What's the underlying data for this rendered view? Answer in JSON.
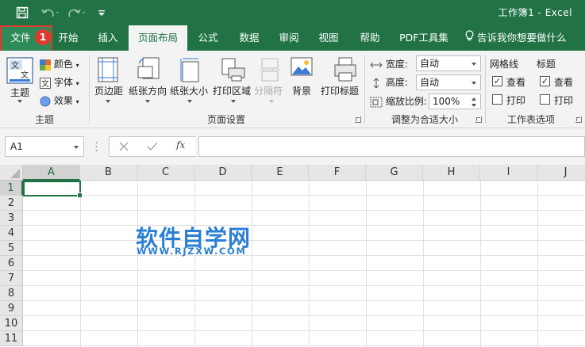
{
  "window": {
    "title": "工作簿1  -  Excel"
  },
  "tabs": [
    {
      "label": "文件"
    },
    {
      "label": "开始"
    },
    {
      "label": "插入"
    },
    {
      "label": "页面布局"
    },
    {
      "label": "公式"
    },
    {
      "label": "数据"
    },
    {
      "label": "审阅"
    },
    {
      "label": "视图"
    },
    {
      "label": "帮助"
    },
    {
      "label": "PDF工具集"
    }
  ],
  "tell_me": "告诉我你想要做什么",
  "badge": "1",
  "ribbon": {
    "themes": {
      "theme_label": "主题",
      "colors_label": "颜色",
      "fonts_label": "字体",
      "effects_label": "效果",
      "group_label": "主题"
    },
    "page_setup": {
      "margins": "页边距",
      "orientation": "纸张方向",
      "size": "纸张大小",
      "print_area": "打印区域",
      "breaks": "分隔符",
      "background": "背景",
      "print_titles": "打印标题",
      "group_label": "页面设置"
    },
    "scale_to_fit": {
      "width_label": "宽度:",
      "width_value": "自动",
      "height_label": "高度:",
      "height_value": "自动",
      "scale_label": "缩放比例:",
      "scale_value": "100%",
      "group_label": "调整为合适大小"
    },
    "sheet_options": {
      "gridlines_label": "网格线",
      "gridlines_view": "查看",
      "gridlines_print": "打印",
      "headings_label": "标题",
      "headings_view": "查看",
      "headings_print": "打印",
      "group_label": "工作表选项"
    }
  },
  "formula_bar": {
    "name_box": "A1",
    "fx": "fx",
    "value": ""
  },
  "columns": [
    "A",
    "B",
    "C",
    "D",
    "E",
    "F",
    "G",
    "H",
    "I",
    "J"
  ],
  "rows": [
    "1",
    "2",
    "3",
    "4",
    "5",
    "6",
    "7",
    "8",
    "9",
    "10",
    "11"
  ],
  "watermark": {
    "title": "软件自学网",
    "url": "WWW.RJZXW.COM"
  },
  "colors": {
    "accent": "#217346",
    "highlight": "#e03a2f",
    "watermark": "#2a7fd4"
  }
}
